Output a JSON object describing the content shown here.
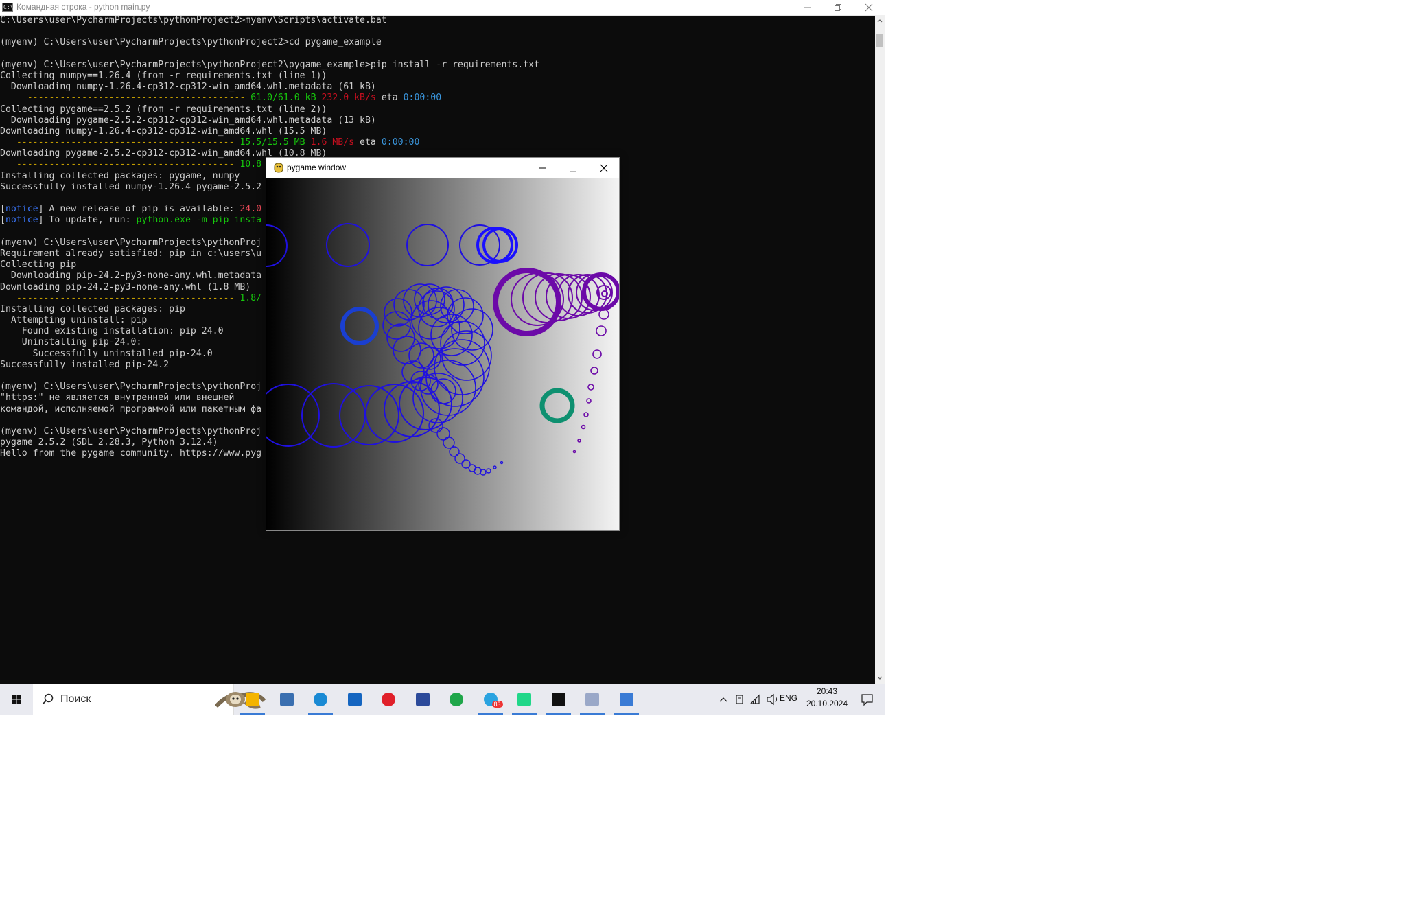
{
  "console": {
    "title": "Командная строка - python  main.py",
    "lines": [
      [
        {
          "t": "C:\\Users\\user\\PycharmProjects\\pythonProject2>myenv\\Scripts\\activate.bat"
        }
      ],
      [
        {
          "t": ""
        }
      ],
      [
        {
          "t": "(myenv) C:\\Users\\user\\PycharmProjects\\pythonProject2>cd pygame_example"
        }
      ],
      [
        {
          "t": ""
        }
      ],
      [
        {
          "t": "(myenv) C:\\Users\\user\\PycharmProjects\\pythonProject2\\pygame_example>pip install -r requirements.txt"
        }
      ],
      [
        {
          "t": "Collecting numpy==1.26.4 (from -r requirements.txt (line 1))"
        }
      ],
      [
        {
          "t": "  Downloading numpy-1.26.4-cp312-cp312-win_amd64.whl.metadata (61 kB)"
        }
      ],
      [
        {
          "t": "     ---------------------------------------- ",
          "c": "c-yellow"
        },
        {
          "t": "61.0/61.0 kB",
          "c": "c-green"
        },
        {
          "t": " "
        },
        {
          "t": "232.0 kB/s",
          "c": "c-dkred"
        },
        {
          "t": " eta "
        },
        {
          "t": "0:00:00",
          "c": "c-cyan"
        }
      ],
      [
        {
          "t": "Collecting pygame==2.5.2 (from -r requirements.txt (line 2))"
        }
      ],
      [
        {
          "t": "  Downloading pygame-2.5.2-cp312-cp312-win_amd64.whl.metadata (13 kB)"
        }
      ],
      [
        {
          "t": "Downloading numpy-1.26.4-cp312-cp312-win_amd64.whl (15.5 MB)"
        }
      ],
      [
        {
          "t": "   ---------------------------------------- ",
          "c": "c-yellow"
        },
        {
          "t": "15.5/15.5 MB",
          "c": "c-green"
        },
        {
          "t": " "
        },
        {
          "t": "1.6 MB/s",
          "c": "c-dkred"
        },
        {
          "t": " eta "
        },
        {
          "t": "0:00:00",
          "c": "c-cyan"
        }
      ],
      [
        {
          "t": "Downloading pygame-2.5.2-cp312-cp312-win_amd64.whl (10.8 MB)"
        }
      ],
      [
        {
          "t": "   ---------------------------------------- ",
          "c": "c-yellow"
        },
        {
          "t": "10.8",
          "c": "c-green"
        }
      ],
      [
        {
          "t": "Installing collected packages: pygame, numpy"
        }
      ],
      [
        {
          "t": "Successfully installed numpy-1.26.4 pygame-2.5.2"
        }
      ],
      [
        {
          "t": ""
        }
      ],
      [
        {
          "t": "["
        },
        {
          "t": "notice",
          "c": "c-blue"
        },
        {
          "t": "] A new release of pip is available: "
        },
        {
          "t": "24.0",
          "c": "c-red"
        }
      ],
      [
        {
          "t": "["
        },
        {
          "t": "notice",
          "c": "c-blue"
        },
        {
          "t": "] To update, run: "
        },
        {
          "t": "python.exe -m pip insta",
          "c": "c-green"
        }
      ],
      [
        {
          "t": ""
        }
      ],
      [
        {
          "t": "(myenv) C:\\Users\\user\\PycharmProjects\\pythonProj"
        }
      ],
      [
        {
          "t": "Requirement already satisfied: pip in c:\\users\\u"
        },
        {
          "t": "                                                  )"
        }
      ],
      [
        {
          "t": "Collecting pip"
        }
      ],
      [
        {
          "t": "  Downloading pip-24.2-py3-none-any.whl.metadata"
        }
      ],
      [
        {
          "t": "Downloading pip-24.2-py3-none-any.whl (1.8 MB)"
        }
      ],
      [
        {
          "t": "   ---------------------------------------- ",
          "c": "c-yellow"
        },
        {
          "t": "1.8/",
          "c": "c-green"
        }
      ],
      [
        {
          "t": "Installing collected packages: pip"
        }
      ],
      [
        {
          "t": "  Attempting uninstall: pip"
        }
      ],
      [
        {
          "t": "    Found existing installation: pip 24.0"
        }
      ],
      [
        {
          "t": "    Uninstalling pip-24.0:"
        }
      ],
      [
        {
          "t": "      Successfully uninstalled pip-24.0"
        }
      ],
      [
        {
          "t": "Successfully installed pip-24.2"
        }
      ],
      [
        {
          "t": ""
        }
      ],
      [
        {
          "t": "(myenv) C:\\Users\\user\\PycharmProjects\\pythonProj"
        }
      ],
      [
        {
          "t": "\"https:\" не является внутренней или внешней"
        }
      ],
      [
        {
          "t": "командой, исполняемой программой или пакетным фа"
        }
      ],
      [
        {
          "t": ""
        }
      ],
      [
        {
          "t": "(myenv) C:\\Users\\user\\PycharmProjects\\pythonProj"
        }
      ],
      [
        {
          "t": "pygame 2.5.2 (SDL 2.28.3, Python 3.12.4)"
        }
      ],
      [
        {
          "t": "Hello from the pygame community. https://www.pyg"
        }
      ]
    ]
  },
  "pygame_window": {
    "title": "pygame window"
  },
  "taskbar": {
    "search_placeholder": "Поиск",
    "apps": [
      {
        "name": "file-explorer",
        "color": "#f4b400"
      },
      {
        "name": "python-idle",
        "color": "#3a6fb0"
      },
      {
        "name": "edge",
        "color": "#1a8ad4"
      },
      {
        "name": "mail",
        "color": "#1565c0"
      },
      {
        "name": "opera",
        "color": "#e0202a"
      },
      {
        "name": "paint-app",
        "color": "#2c4a9a"
      },
      {
        "name": "browser-e",
        "color": "#1fa64a"
      },
      {
        "name": "telegram",
        "color": "#2aa3e0",
        "badge": "83"
      },
      {
        "name": "pycharm",
        "color": "#21d789"
      },
      {
        "name": "terminal",
        "color": "#111111"
      },
      {
        "name": "paint-brush",
        "color": "#9aa8c8"
      },
      {
        "name": "pygame-app",
        "color": "#3a7bd5"
      }
    ],
    "language": "ENG",
    "time": "20:43",
    "date": "20.10.2024"
  }
}
